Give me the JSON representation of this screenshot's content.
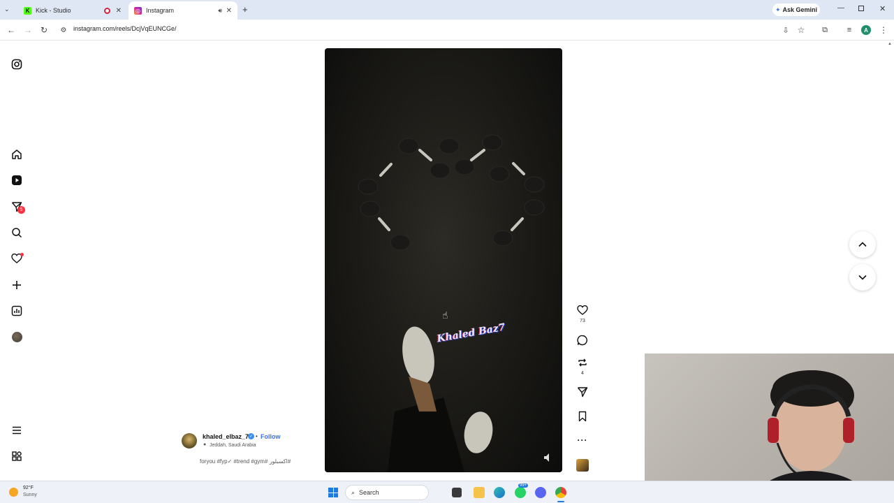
{
  "browser": {
    "tabs": [
      {
        "title": "Kick - Studio",
        "favicon": "kick-icon",
        "color": "#53fc18"
      },
      {
        "title": "Instagram",
        "favicon": "instagram-icon",
        "color": "#d6249f"
      }
    ],
    "ask_gemini": "Ask Gemini",
    "url": "instagram.com/reels/DcjVqEUNCGe/",
    "profile_initial": "A"
  },
  "sidebar": {
    "notifications_badge": "5"
  },
  "reel": {
    "watermark": "Khaled Baz7",
    "owner": "khaled_elbaz_7",
    "follow": "Follow",
    "separator": "•",
    "location": "Jeddah, Saudi Arabia",
    "caption": "foryou #fyp✓ #trend #gym# اكسبلور#",
    "likes": "73",
    "reposts": "4"
  },
  "taskbar": {
    "temperature": "92°F",
    "weather": "Sunny",
    "search": "Search",
    "whatsapp_badge": "99+"
  },
  "colors": {
    "accent_blue": "#3a6ff0",
    "notif_red": "#ff3040"
  }
}
